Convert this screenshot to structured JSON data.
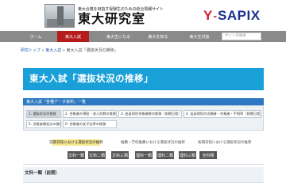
{
  "header": {
    "tagline": "東大合格を目指す受験生のための総合情報サイト",
    "site_title": "東大研究室",
    "partner_logo": {
      "y": "Y",
      "dash": "-",
      "name": "SAPIX"
    }
  },
  "nav": {
    "items": [
      {
        "label": "ホーム",
        "active": false
      },
      {
        "label": "東大入試",
        "active": true
      },
      {
        "label": "東大生になる",
        "active": false
      },
      {
        "label": "東大を知る",
        "active": false
      },
      {
        "label": "東大生対談",
        "active": false
      }
    ],
    "search_placeholder": "サイト内検索"
  },
  "breadcrumb": {
    "items": [
      "研究トップ",
      "東大入試",
      "東大入試「選抜状況の推移」"
    ],
    "separator": "»"
  },
  "page_title": "東大入試「選抜状況の推移」",
  "subheader": "東大入試「各種データ資料」一覧",
  "data_tabs": [
    {
      "label": "1. 選抜状況の推移",
      "active": true
    },
    {
      "label": "2. 合格者の現役・浪人別数の推移",
      "active": false
    },
    {
      "label": "3. 出身地別合格者数の推移（前期日程）",
      "active": false
    },
    {
      "label": "4. 出身地別の志願者・合格者・手続率（前期日程）",
      "active": false
    },
    {
      "label": "5. 合格者最低点の推移",
      "active": false
    },
    {
      "label": "6. 合格者の女子比率の推移",
      "active": false
    }
  ],
  "legend": {
    "highlight": "前期日程における選抜状況の推移",
    "second": "推薦・学校推薦における選抜状況の推移",
    "third": "後期日程における選抜状況の推移"
  },
  "subject_buttons": [
    "文科一類",
    "文科二類",
    "文科三類",
    "理科一類",
    "理科二類",
    "理科三類",
    "全科類"
  ],
  "section_title": "文科一類（前期）",
  "colors": {
    "nav_bg": "#8a8a8a",
    "nav_active": "#b71c1c",
    "title_bar": "#1aa0d8",
    "subheader": "#2c78c2",
    "legend_highlight": "#f6e78d",
    "subject_button": "#555555",
    "sapix_red": "#d2202f",
    "sapix_blue": "#1b2f8c"
  },
  "icons": {
    "logo": "yasuda-auditorium-logo"
  }
}
